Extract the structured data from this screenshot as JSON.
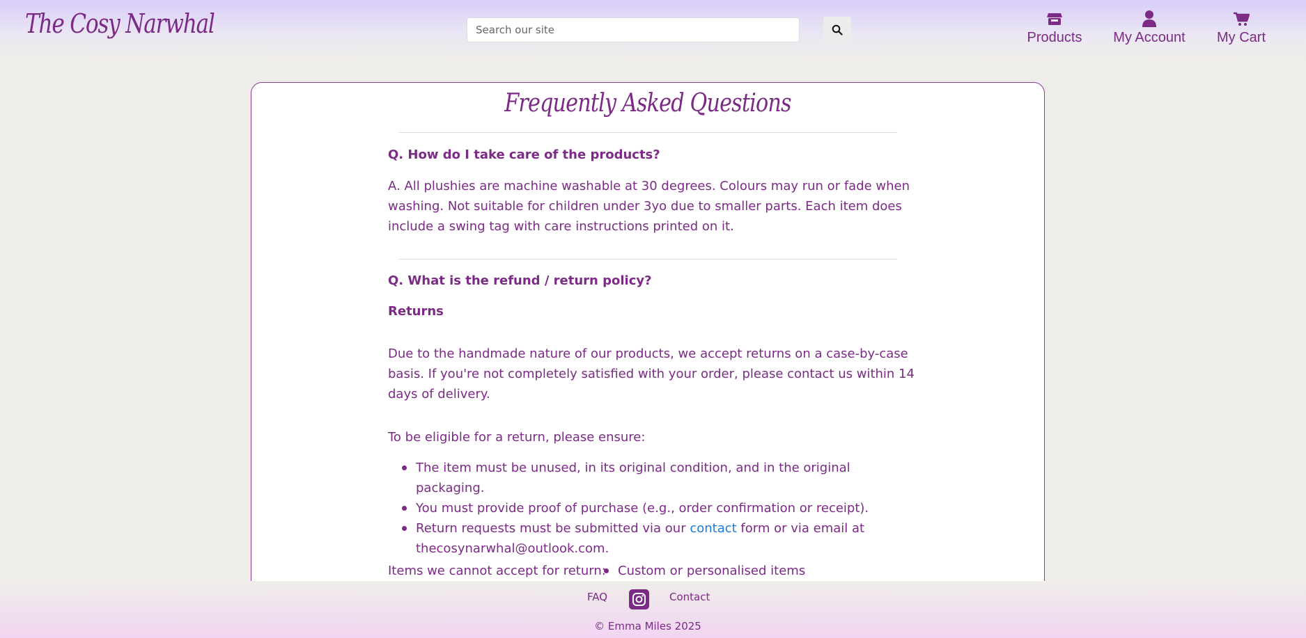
{
  "brand": {
    "logo_text": "The Cosy Narwhal",
    "accent_color": "#7b2a86",
    "link_color": "#1a7bd6"
  },
  "search": {
    "placeholder": "Search our site",
    "button_icon": "search-icon"
  },
  "nav": [
    {
      "label": "Products",
      "icon": "store-icon"
    },
    {
      "label": "My Account",
      "icon": "user-icon"
    },
    {
      "label": "My Cart",
      "icon": "cart-icon"
    }
  ],
  "faq": {
    "title": "Frequently Asked Questions",
    "q1": {
      "question": "Q. How do I take care of the products?",
      "answer": "A. All plushies are machine washable at 30 degrees. Colours may run or fade when washing. Not suitable for children under 3yo due to smaller parts. Each item does include a swing tag with care instructions printed on it."
    },
    "q2": {
      "question": "Q. What is the refund / return policy?",
      "returns_heading": "Returns",
      "returns_intro": "Due to the handmade nature of our products, we accept returns on a case-by-case basis. If you're not completely satisfied with your order, please contact us within 14 days of delivery.",
      "eligibility_intro": "To be eligible for a return, please ensure:",
      "eligibility": [
        "The item must be unused, in its original condition, and in the original packaging.",
        "You must provide proof of purchase (e.g., order confirmation or receipt)."
      ],
      "eligibility_3_before": "Return requests must be submitted via our ",
      "eligibility_3_link": "contact",
      "eligibility_3_after": " form or via email at thecosynarwhal@outlook.com.",
      "not_accepted_intro": "Items we cannot accept for return:",
      "not_accepted": [
        "Custom or personalised items"
      ]
    }
  },
  "footer": {
    "faq_label": "FAQ",
    "instagram_icon": "instagram-icon",
    "contact_label": "Contact",
    "copyright": "© Emma Miles 2025"
  }
}
